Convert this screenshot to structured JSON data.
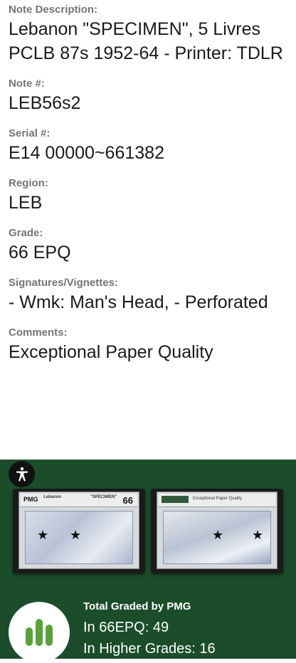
{
  "details": [
    {
      "key": "note_description",
      "label": "Note Description:",
      "value": "Lebanon \"SPECIMEN\", 5 Livres PCLB 87s 1952-64 - Printer: TDLR"
    },
    {
      "key": "note_number",
      "label": "Note #:",
      "value": "LEB56s2"
    },
    {
      "key": "serial",
      "label": "Serial #:",
      "value": "E14 00000~661382"
    },
    {
      "key": "region",
      "label": "Region:",
      "value": "LEB"
    },
    {
      "key": "grade",
      "label": "Grade:",
      "value": "66 EPQ"
    },
    {
      "key": "signatures",
      "label": "Signatures/Vignettes:",
      "value": "- Wmk: Man's Head, - Perforated"
    },
    {
      "key": "comments",
      "label": "Comments:",
      "value": "Exceptional Paper Quality"
    }
  ],
  "images": {
    "front": {
      "label_title": "Lebanon",
      "label_specimen": "\"SPECIMEN\"",
      "label_grade": "66",
      "pmg": "PMG"
    },
    "back": {
      "label_title": "Exceptional Paper Quality"
    }
  },
  "stats": {
    "title": "Total Graded by PMG",
    "line1": "In 66EPQ: 49",
    "line2": "In Higher Grades: 16"
  },
  "colors": {
    "band": "#1b4d2a",
    "accent": "#5aa13c"
  },
  "icons": {
    "accessibility": "accessibility-icon",
    "chart": "bar-chart-icon"
  }
}
